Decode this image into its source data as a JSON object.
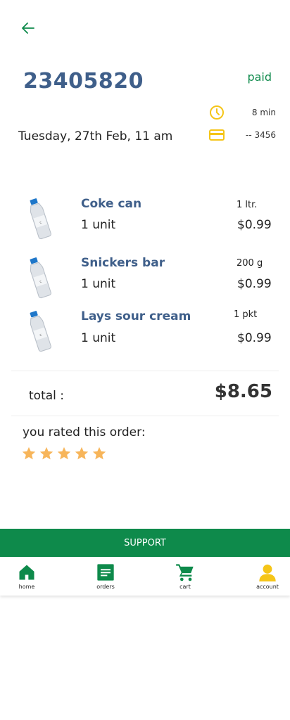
{
  "header": {
    "order_number": "23405820",
    "status": "paid",
    "date": "Tuesday, 27th Feb, 11 am",
    "eta": "8 min",
    "card": "-- 3456"
  },
  "items": [
    {
      "name": "Coke can",
      "quantity": "1 unit",
      "size": "1 ltr.",
      "price": "$0.99"
    },
    {
      "name": "Snickers bar",
      "quantity": "1 unit",
      "size": "200 g",
      "price": "$0.99"
    },
    {
      "name": "Lays sour cream",
      "quantity": "1 unit",
      "size": "1 pkt",
      "price": "$0.99"
    }
  ],
  "summary": {
    "total_label": "total :",
    "total_value": "$8.65"
  },
  "rating": {
    "label": "you rated this order:",
    "stars": 5,
    "max_stars": 5
  },
  "support_label": "SUPPORT",
  "nav": [
    {
      "label": "home",
      "icon": "home-icon"
    },
    {
      "label": "orders",
      "icon": "orders-icon"
    },
    {
      "label": "cart",
      "icon": "cart-icon"
    },
    {
      "label": "account",
      "icon": "account-icon"
    }
  ],
  "colors": {
    "brand_green": "#0e8a4b",
    "title_blue": "#3f5f8a",
    "accent_yellow": "#f5c518",
    "star_color": "#f7b55a"
  }
}
